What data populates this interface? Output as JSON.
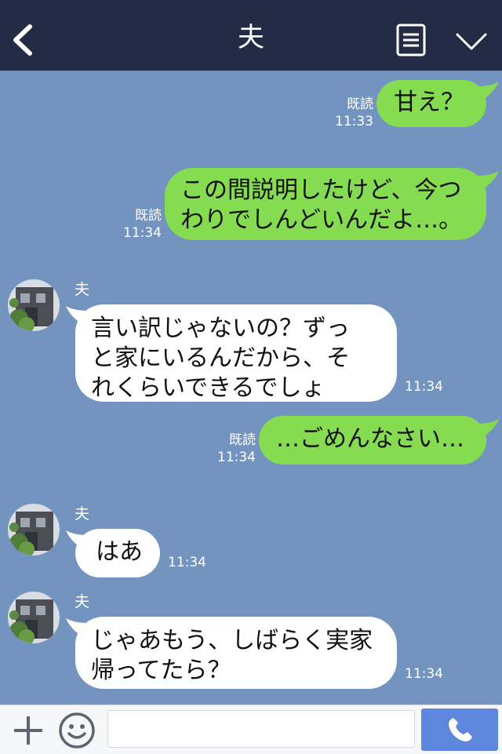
{
  "header": {
    "title": "夫",
    "icons": [
      "back-chevron-icon",
      "menu-list-icon",
      "chevron-down-icon"
    ]
  },
  "colors": {
    "header_bg": "#232c44",
    "chat_bg": "#7494c0",
    "sent_bubble": "#86dc50",
    "received_bubble": "#ffffff",
    "call_button": "#5d86dc"
  },
  "messages": [
    {
      "type": "sent",
      "read_label": "既読",
      "time": "11:33",
      "text": "甘え？"
    },
    {
      "type": "sent",
      "read_label": "既読",
      "time": "11:34",
      "line1": "この間説明したけど、今つ",
      "line2": "わりでしんどいんだよ…。"
    },
    {
      "type": "received",
      "sender": "夫",
      "time": "11:34",
      "line1": "言い訳じゃないの？ずっ",
      "line2": "と家にいるんだから、そ",
      "line3": "れくらいできるでしょ"
    },
    {
      "type": "sent",
      "read_label": "既読",
      "time": "11:34",
      "text": "…ごめんなさい…"
    },
    {
      "type": "received",
      "sender": "夫",
      "time": "11:34",
      "text": "はあ"
    },
    {
      "type": "received",
      "sender": "夫",
      "time": "11:34",
      "line1": "じゃあもう、しばらく実家",
      "line2": "帰ってたら？"
    }
  ],
  "footer": {
    "input_value": "",
    "icons": [
      "plus-icon",
      "emoji-icon",
      "phone-icon"
    ]
  }
}
